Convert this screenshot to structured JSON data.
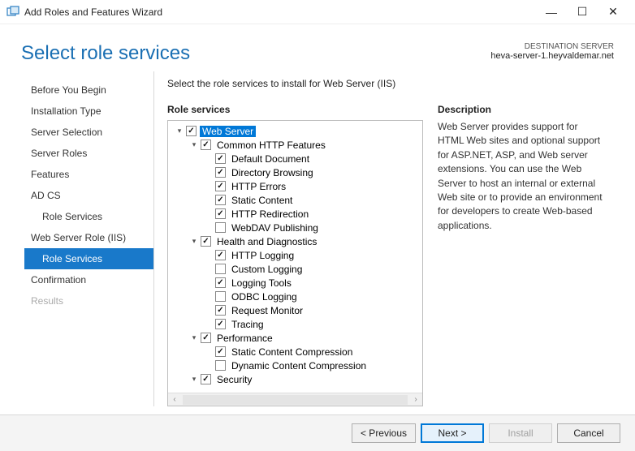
{
  "window": {
    "title": "Add Roles and Features Wizard"
  },
  "header": {
    "page_title": "Select role services",
    "dest_label": "DESTINATION SERVER",
    "dest_server": "heva-server-1.heyvaldemar.net"
  },
  "sidebar": {
    "steps": [
      {
        "label": "Before You Begin",
        "sub": false,
        "active": false,
        "disabled": false
      },
      {
        "label": "Installation Type",
        "sub": false,
        "active": false,
        "disabled": false
      },
      {
        "label": "Server Selection",
        "sub": false,
        "active": false,
        "disabled": false
      },
      {
        "label": "Server Roles",
        "sub": false,
        "active": false,
        "disabled": false
      },
      {
        "label": "Features",
        "sub": false,
        "active": false,
        "disabled": false
      },
      {
        "label": "AD CS",
        "sub": false,
        "active": false,
        "disabled": false
      },
      {
        "label": "Role Services",
        "sub": true,
        "active": false,
        "disabled": false
      },
      {
        "label": "Web Server Role (IIS)",
        "sub": false,
        "active": false,
        "disabled": false
      },
      {
        "label": "Role Services",
        "sub": true,
        "active": true,
        "disabled": false
      },
      {
        "label": "Confirmation",
        "sub": false,
        "active": false,
        "disabled": false
      },
      {
        "label": "Results",
        "sub": false,
        "active": false,
        "disabled": true
      }
    ]
  },
  "main": {
    "instruction": "Select the role services to install for Web Server (IIS)",
    "subheading": "Role services",
    "tree": [
      {
        "depth": 0,
        "expander": "▾",
        "checked": true,
        "label": "Web Server",
        "selected": true
      },
      {
        "depth": 1,
        "expander": "▾",
        "checked": true,
        "label": "Common HTTP Features",
        "selected": false
      },
      {
        "depth": 2,
        "expander": "",
        "checked": true,
        "label": "Default Document",
        "selected": false
      },
      {
        "depth": 2,
        "expander": "",
        "checked": true,
        "label": "Directory Browsing",
        "selected": false
      },
      {
        "depth": 2,
        "expander": "",
        "checked": true,
        "label": "HTTP Errors",
        "selected": false
      },
      {
        "depth": 2,
        "expander": "",
        "checked": true,
        "label": "Static Content",
        "selected": false
      },
      {
        "depth": 2,
        "expander": "",
        "checked": true,
        "label": "HTTP Redirection",
        "selected": false
      },
      {
        "depth": 2,
        "expander": "",
        "checked": false,
        "label": "WebDAV Publishing",
        "selected": false
      },
      {
        "depth": 1,
        "expander": "▾",
        "checked": true,
        "label": "Health and Diagnostics",
        "selected": false
      },
      {
        "depth": 2,
        "expander": "",
        "checked": true,
        "label": "HTTP Logging",
        "selected": false
      },
      {
        "depth": 2,
        "expander": "",
        "checked": false,
        "label": "Custom Logging",
        "selected": false
      },
      {
        "depth": 2,
        "expander": "",
        "checked": true,
        "label": "Logging Tools",
        "selected": false
      },
      {
        "depth": 2,
        "expander": "",
        "checked": false,
        "label": "ODBC Logging",
        "selected": false
      },
      {
        "depth": 2,
        "expander": "",
        "checked": true,
        "label": "Request Monitor",
        "selected": false
      },
      {
        "depth": 2,
        "expander": "",
        "checked": true,
        "label": "Tracing",
        "selected": false
      },
      {
        "depth": 1,
        "expander": "▾",
        "checked": true,
        "label": "Performance",
        "selected": false
      },
      {
        "depth": 2,
        "expander": "",
        "checked": true,
        "label": "Static Content Compression",
        "selected": false
      },
      {
        "depth": 2,
        "expander": "",
        "checked": false,
        "label": "Dynamic Content Compression",
        "selected": false
      },
      {
        "depth": 1,
        "expander": "▾",
        "checked": true,
        "label": "Security",
        "selected": false
      }
    ]
  },
  "description": {
    "heading": "Description",
    "text": "Web Server provides support for HTML Web sites and optional support for ASP.NET, ASP, and Web server extensions. You can use the Web Server to host an internal or external Web site or to provide an environment for developers to create Web-based applications."
  },
  "footer": {
    "previous": "< Previous",
    "next": "Next >",
    "install": "Install",
    "cancel": "Cancel"
  }
}
